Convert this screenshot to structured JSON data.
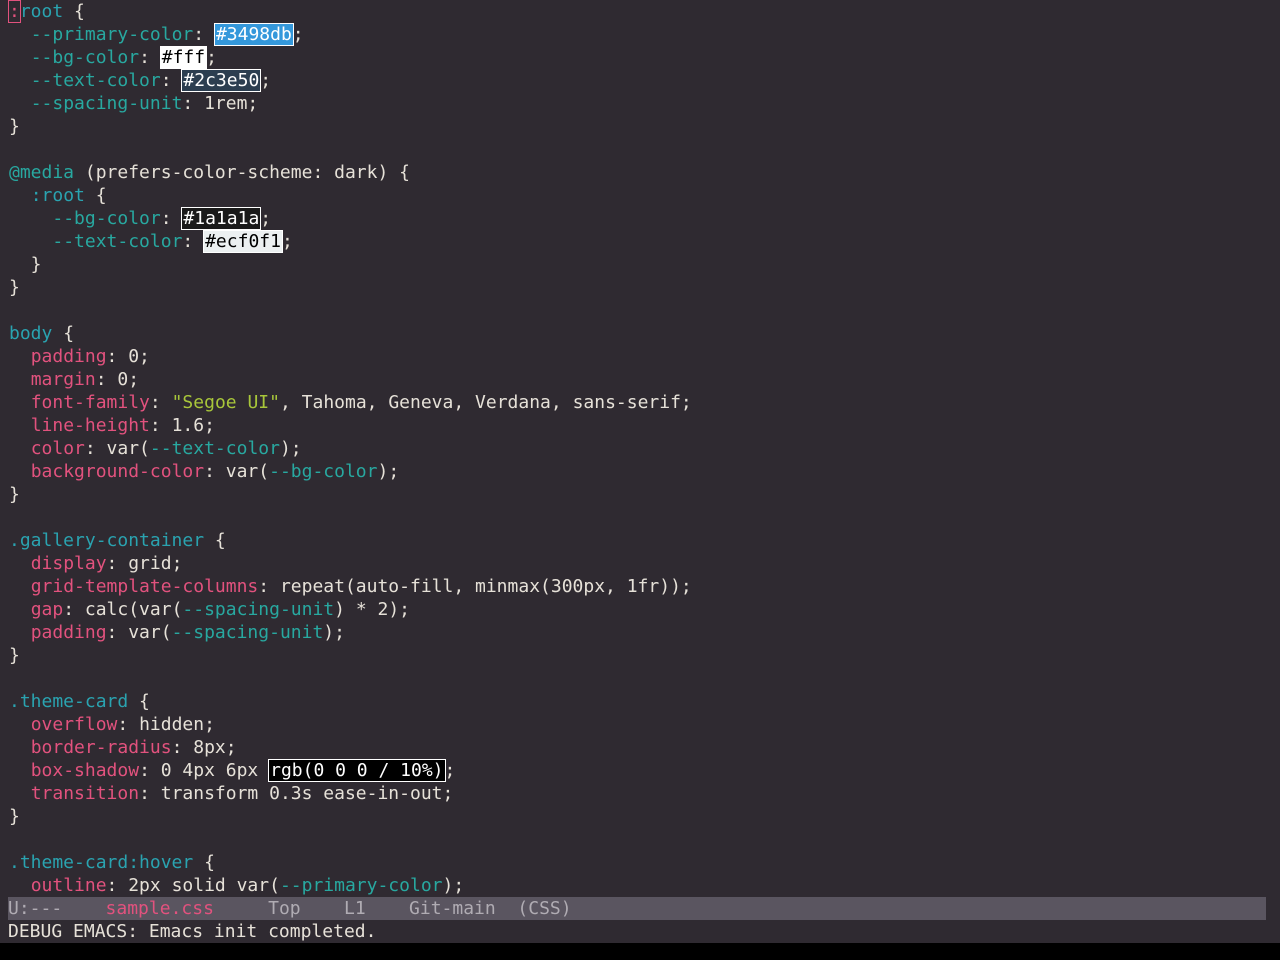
{
  "colors": {
    "primary_swatch": "#3498db",
    "bg_swatch": "#ffffff",
    "text_swatch": "#2c3e50",
    "dark_bg_swatch": "#1a1a1a",
    "dark_text_swatch": "#ecf0f1",
    "shadow_swatch": "#000000"
  },
  "code": {
    "l1": {
      "c": ":",
      "a": "root",
      "b": " {"
    },
    "l2": {
      "i": "  ",
      "p": "--primary-color",
      "s": ": ",
      "v": "#3498db",
      "e": ";"
    },
    "l3": {
      "i": "  ",
      "p": "--bg-color",
      "s": ": ",
      "v": "#fff",
      "e": ";"
    },
    "l4": {
      "i": "  ",
      "p": "--text-color",
      "s": ": ",
      "v": "#2c3e50",
      "e": ";"
    },
    "l5": {
      "i": "  ",
      "p": "--spacing-unit",
      "s": ": 1rem;"
    },
    "l6": "}",
    "l7": "",
    "l8": {
      "a": "@media",
      "b": " (prefers-color-scheme: dark) {"
    },
    "l9": {
      "i": "  ",
      "a": ":root",
      "b": " {"
    },
    "l10": {
      "i": "    ",
      "p": "--bg-color",
      "s": ": ",
      "v": "#1a1a1a",
      "e": ";"
    },
    "l11": {
      "i": "    ",
      "p": "--text-color",
      "s": ": ",
      "v": "#ecf0f1",
      "e": ";"
    },
    "l12": "  }",
    "l13": "}",
    "l14": "",
    "l15": {
      "a": "body",
      "b": " {"
    },
    "l16": {
      "i": "  ",
      "p": "padding",
      "s": ": 0;"
    },
    "l17": {
      "i": "  ",
      "p": "margin",
      "s": ": 0;"
    },
    "l18": {
      "i": "  ",
      "p": "font-family",
      "s": ": ",
      "str": "\"Segoe UI\"",
      "e": ", Tahoma, Geneva, Verdana, sans-serif;"
    },
    "l19": {
      "i": "  ",
      "p": "line-height",
      "s": ": 1.6;"
    },
    "l20": {
      "i": "  ",
      "p": "color",
      "s": ": var(",
      "v": "--text-color",
      "e": ");"
    },
    "l21": {
      "i": "  ",
      "p": "background-color",
      "s": ": var(",
      "v": "--bg-color",
      "e": ");"
    },
    "l22": "}",
    "l23": "",
    "l24": {
      "a": ".gallery-container",
      "b": " {"
    },
    "l25": {
      "i": "  ",
      "p": "display",
      "s": ": grid;"
    },
    "l26": {
      "i": "  ",
      "p": "grid-template-columns",
      "s": ": repeat(auto-fill, minmax(300px, 1fr));"
    },
    "l27": {
      "i": "  ",
      "p": "gap",
      "s": ": calc(var(",
      "v": "--spacing-unit",
      "e": ") * 2);"
    },
    "l28": {
      "i": "  ",
      "p": "padding",
      "s": ": var(",
      "v": "--spacing-unit",
      "e": ");"
    },
    "l29": "}",
    "l30": "",
    "l31": {
      "a": ".theme-card",
      "b": " {"
    },
    "l32": {
      "i": "  ",
      "p": "overflow",
      "s": ": hidden;"
    },
    "l33": {
      "i": "  ",
      "p": "border-radius",
      "s": ": 8px;"
    },
    "l34": {
      "i": "  ",
      "p": "box-shadow",
      "s": ": 0 4px 6px ",
      "v": "rgb(0 0 0 / 10%)",
      "e": ";"
    },
    "l35": {
      "i": "  ",
      "p": "transition",
      "s": ": transform 0.3s ease-in-out;"
    },
    "l36": "}",
    "l37": "",
    "l38": {
      "a": ".theme-card:hover",
      "b": " {"
    },
    "l39": {
      "i": "  ",
      "p": "outline",
      "s": ": 2px solid var(",
      "v": "--primary-color",
      "e": ");"
    }
  },
  "modeline": {
    "status": "U:---",
    "buffer": "sample.css",
    "position": "Top",
    "line": "L1",
    "vc": "Git-main",
    "mode": "(CSS)"
  },
  "echo_area": "DEBUG EMACS: Emacs init completed."
}
